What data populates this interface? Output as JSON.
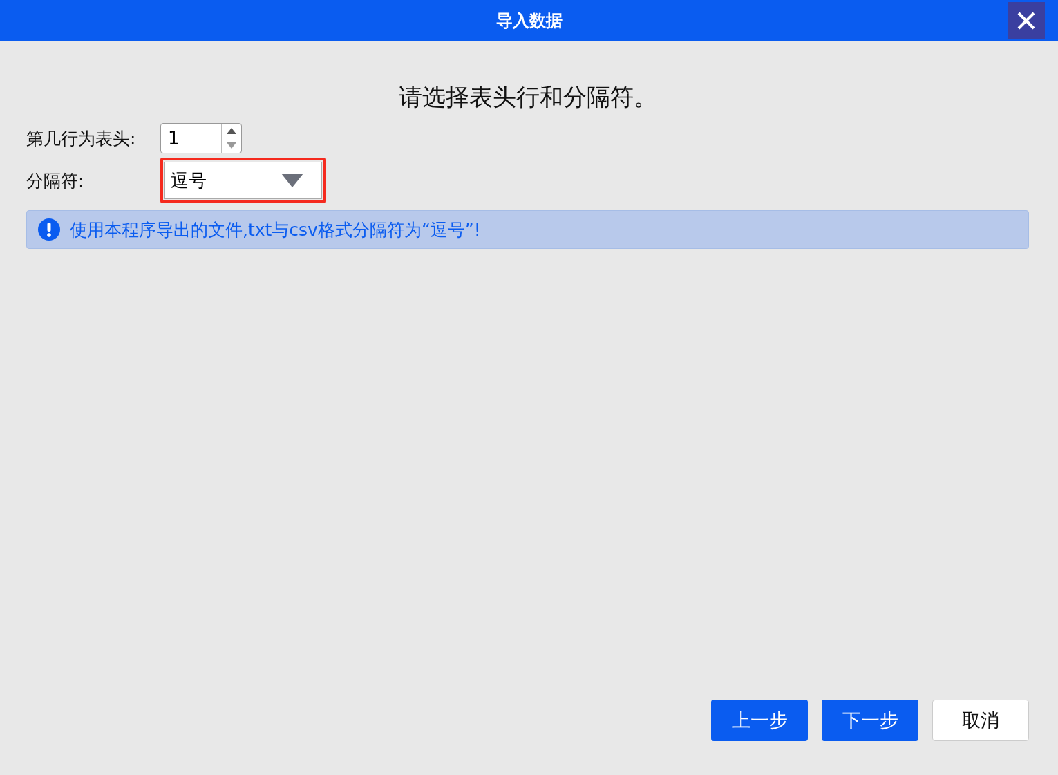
{
  "window": {
    "title": "导入数据"
  },
  "heading": "请选择表头行和分隔符。",
  "header_row": {
    "label": "第几行为表头:",
    "value": "1"
  },
  "separator": {
    "label": "分隔符:",
    "value": "逗号",
    "highlighted": true
  },
  "notice": {
    "text": "使用本程序导出的文件,txt与csv格式分隔符为“逗号”!"
  },
  "buttons": [
    {
      "label": "上一步",
      "kind": "primary"
    },
    {
      "label": "下一步",
      "kind": "primary"
    },
    {
      "label": "取消",
      "kind": "secondary"
    }
  ]
}
